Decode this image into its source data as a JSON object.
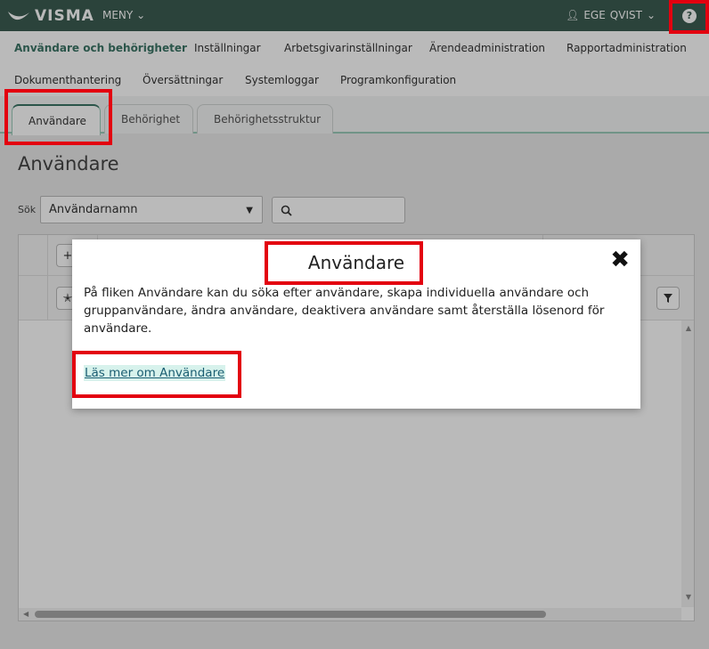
{
  "topbar": {
    "logo_text": "VISMA",
    "menu_label": "MENY",
    "user_first": "EGE",
    "user_last": "QVIST",
    "help_label": "?"
  },
  "nav": {
    "items": [
      "Användare och behörigheter",
      "Inställningar",
      "Arbetsgivarinställningar",
      "Ärendeadministration",
      "Rapportadministration",
      "Dokumenthantering",
      "Översättningar",
      "Systemloggar",
      "Programkonfiguration"
    ]
  },
  "tabs": [
    "Användare",
    "Behörighet",
    "Behörighetsstruktur"
  ],
  "page": {
    "title": "Användare",
    "search_label": "Sök",
    "search_field": "Användarnamn",
    "search_placeholder": ""
  },
  "modal": {
    "title": "Användare",
    "close": "✖",
    "body": "På fliken Användare kan du söka efter användare, skapa individuella användare och gruppanvändare, ändra användare, deaktivera användare samt återställa lösenord för användare.",
    "link": "Läs mer om Användare"
  },
  "colors": {
    "topbar": "#3b5d52",
    "accent": "#3b7566",
    "highlight": "#e3000f"
  }
}
